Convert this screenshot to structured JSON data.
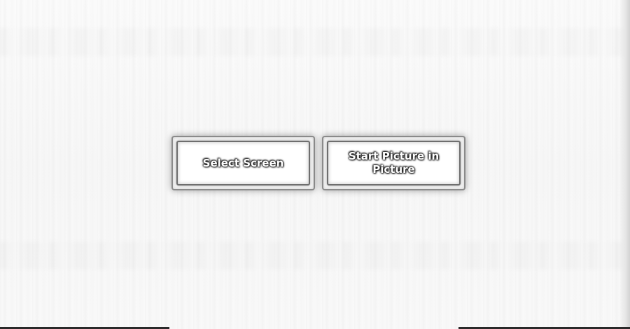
{
  "window": {
    "background_color": "#f8f8f8"
  },
  "actions": {
    "select_screen_label": "Select Screen",
    "start_pip_label": "Start Picture in Picture"
  }
}
